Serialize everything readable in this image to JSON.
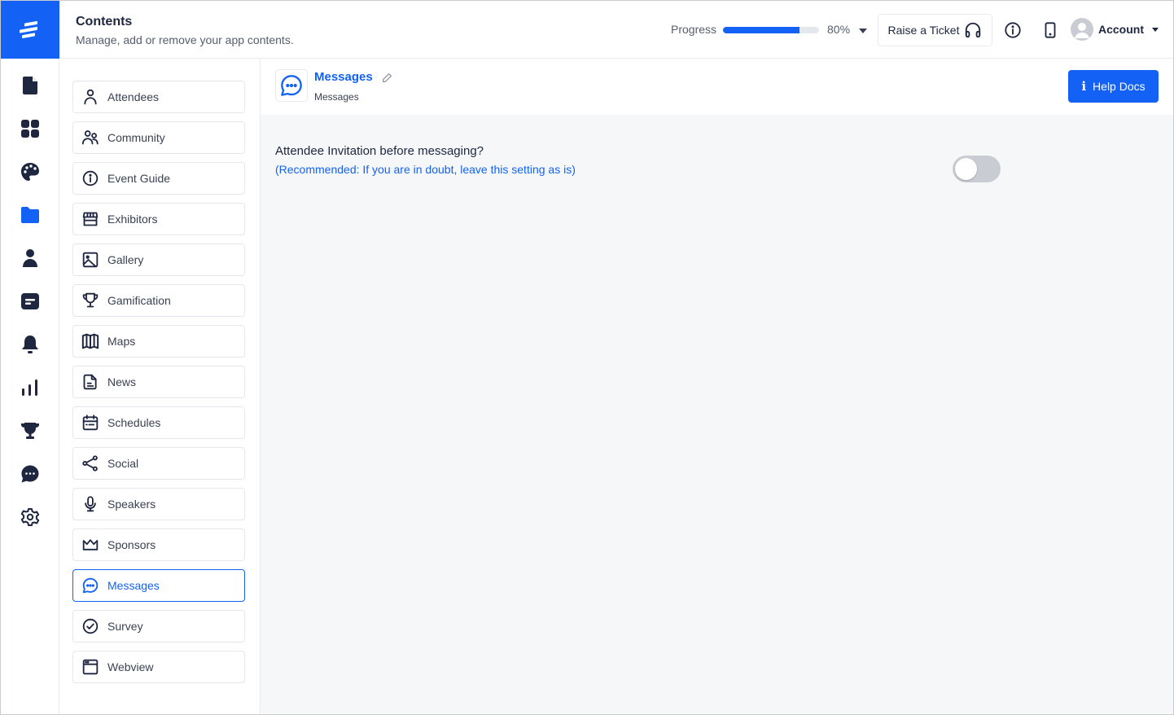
{
  "header": {
    "title": "Contents",
    "subtitle": "Manage, add or remove your app contents.",
    "progress_label": "Progress",
    "progress_value": 80,
    "progress_text": "80%",
    "raise_ticket_label": "Raise a Ticket",
    "account_label": "Account"
  },
  "rail": {
    "items": [
      {
        "icon": "document-icon",
        "active": false
      },
      {
        "icon": "grid-icon",
        "active": false
      },
      {
        "icon": "palette-icon",
        "active": false
      },
      {
        "icon": "folder-icon",
        "active": true
      },
      {
        "icon": "user-icon",
        "active": false
      },
      {
        "icon": "message-square-icon",
        "active": false
      },
      {
        "icon": "bell-icon",
        "active": false
      },
      {
        "icon": "bar-chart-icon",
        "active": false
      },
      {
        "icon": "trophy-icon",
        "active": false
      },
      {
        "icon": "chat-bubble-icon",
        "active": false
      },
      {
        "icon": "gear-icon",
        "active": false
      }
    ]
  },
  "content_list": {
    "items": [
      {
        "label": "Attendees",
        "icon": "user-outline-icon"
      },
      {
        "label": "Community",
        "icon": "users-icon"
      },
      {
        "label": "Event Guide",
        "icon": "info-circle-icon"
      },
      {
        "label": "Exhibitors",
        "icon": "storefront-icon"
      },
      {
        "label": "Gallery",
        "icon": "image-icon"
      },
      {
        "label": "Gamification",
        "icon": "trophy-outline-icon"
      },
      {
        "label": "Maps",
        "icon": "map-icon"
      },
      {
        "label": "News",
        "icon": "news-document-icon"
      },
      {
        "label": "Schedules",
        "icon": "calendar-icon"
      },
      {
        "label": "Social",
        "icon": "share-icon"
      },
      {
        "label": "Speakers",
        "icon": "microphone-icon"
      },
      {
        "label": "Sponsors",
        "icon": "crown-icon"
      },
      {
        "label": "Messages",
        "icon": "chat-bubble-outline-icon",
        "active": true
      },
      {
        "label": "Survey",
        "icon": "check-circle-icon"
      },
      {
        "label": "Webview",
        "icon": "browser-window-icon"
      }
    ]
  },
  "main": {
    "title": "Messages",
    "subtitle": "Messages",
    "help_docs_label": "Help Docs",
    "setting": {
      "title": "Attendee Invitation before messaging?",
      "hint": "(Recommended: If you are in doubt, leave this setting as is)",
      "enabled": false
    }
  },
  "colors": {
    "accent": "#1362f5",
    "icon_dark": "#1e2640",
    "toggle_off": "#c9ccd2",
    "main_bg": "#f6f7f9"
  }
}
